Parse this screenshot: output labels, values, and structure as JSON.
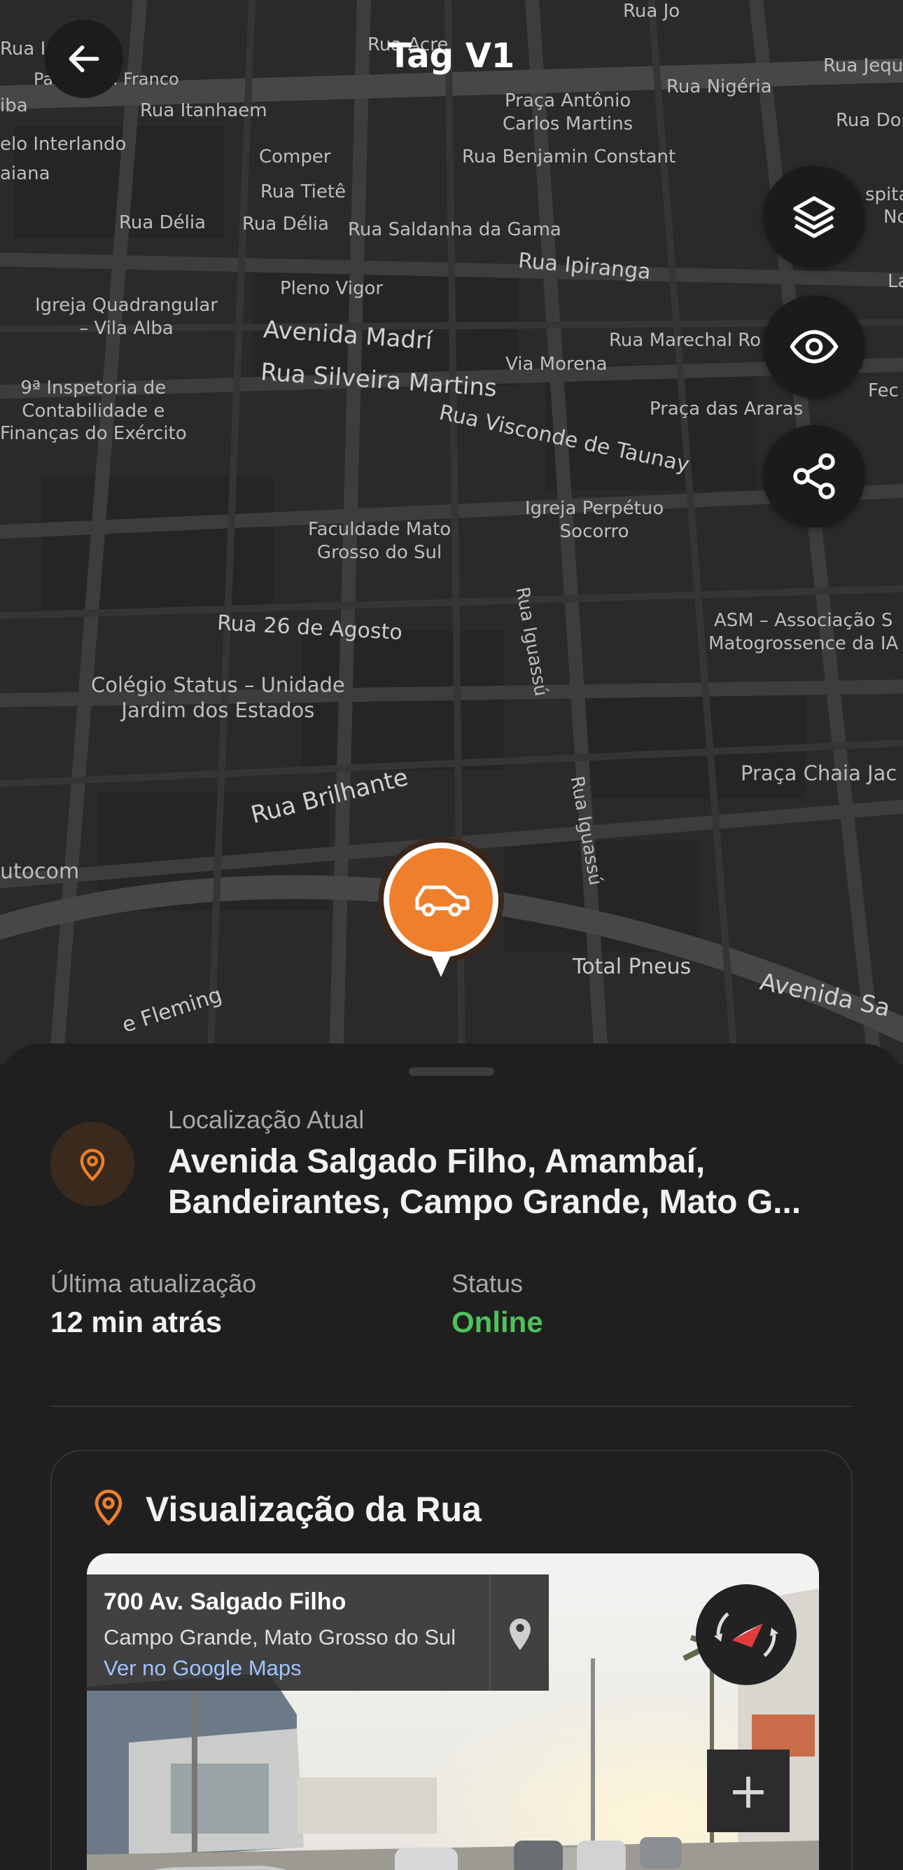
{
  "header": {
    "title": "Tag V1"
  },
  "map": {
    "labels": {
      "l1": "Rua Jo",
      "l2": "Rua Acre",
      "l3": "Rua Ipanema",
      "l4": "Padaria R. Franco",
      "l5": "Rua Itanhaem",
      "l6": "iba",
      "l7": "elo Interlando",
      "l8": "aiana",
      "l9": "Comper",
      "l10": "Rua Tietê",
      "l11": "Rua Délia",
      "l12": "Rua Délia",
      "l13": "Rua Saldanha da Gama",
      "l14": "Praça Antônio\nCarlos Martins",
      "l15": "Rua Nigéria",
      "l16": "Rua Jequi",
      "l17": "Rua Dom",
      "l18": "Rua Benjamin Constant",
      "l19": "Rua Ipiranga",
      "l20": "Pleno Vigor",
      "l21": "Igreja Quadrangular\n– Vila Alba",
      "l22": "Avenida Madrí",
      "l23": "Via Morena",
      "l24": "Rua Marechal Ro",
      "l25": "Rua Silveira Martins",
      "l26": "9ª Inspetoria de\nContabilidade e\nFinanças do Exército",
      "l27": "Praça das Araras",
      "l28": "Rua Visconde de Taunay",
      "l29": "Igreja Perpétuo\nSocorro",
      "l30": "Faculdade Mato\nGrosso do Sul",
      "l31": "Rua Iguassú",
      "l32": "ASM – Associação S\nMatogrossence da IA",
      "l33": "Rua 26 de Agosto",
      "l34": "Colégio Status – Unidade\nJardim dos Estados",
      "l35": "Praça Chaia Jac",
      "l36": "Rua Brilhante",
      "l37": "Rua Iguassú",
      "l38": "utocom",
      "l39": "Total Pneus",
      "l40": "Avenida Sa",
      "l41": "e Fleming",
      "l42": "spita",
      "l43": "No",
      "l44": "La",
      "l45": "Fec"
    }
  },
  "location": {
    "caption": "Localização Atual",
    "address": "Avenida Salgado Filho, Amambaí, Bandeirantes, Campo Grande, Mato G..."
  },
  "update": {
    "caption": "Última atualização",
    "value": "12 min atrás"
  },
  "status": {
    "caption": "Status",
    "value": "Online"
  },
  "street_view": {
    "title": "Visualização da Rua",
    "address": "700 Av. Salgado Filho",
    "city": "Campo Grande, Mato Grosso do Sul",
    "link": "Ver no Google Maps",
    "zoom_label": "+"
  },
  "colors": {
    "accent": "#EE7F2D",
    "online": "#4FC15A",
    "background": "#1F1F1F"
  }
}
